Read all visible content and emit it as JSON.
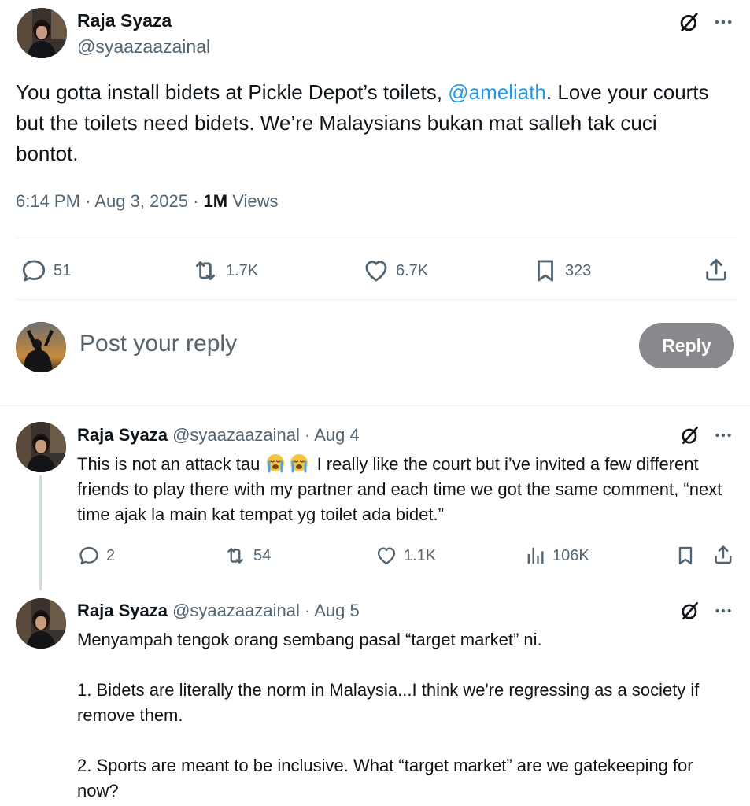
{
  "main_tweet": {
    "author_name": "Raja Syaza",
    "author_handle": "@syaazaazainal",
    "text_before": "You gotta install bidets at Pickle Depot’s toilets, ",
    "mention": "@ameliath",
    "text_after": ". Love your courts  but the toilets need bidets. We’re Malaysians bukan mat salleh tak cuci bontot.",
    "time": "6:14 PM",
    "date": "Aug 3, 2025",
    "views_count": "1M",
    "views_label": "Views",
    "separator": "·",
    "actions": {
      "replies": "51",
      "reposts": "1.7K",
      "likes": "6.7K",
      "bookmarks": "323"
    }
  },
  "composer": {
    "placeholder": "Post your reply",
    "reply_button": "Reply"
  },
  "replies": [
    {
      "author_name": "Raja Syaza",
      "author_handle": "@syaazaazainal",
      "date": "Aug 4",
      "text_first": "This is not an attack tau",
      "text_rest": " I really like the court but i’ve invited a few different friends to play there with my partner and each time we got the same comment, “next time ajak la main kat tempat yg toilet ada bidet.”",
      "actions": {
        "replies": "2",
        "reposts": "54",
        "likes": "1.1K",
        "views": "106K"
      }
    },
    {
      "author_name": "Raja Syaza",
      "author_handle": "@syaazaazainal",
      "date": "Aug 5",
      "paragraphs": [
        "Menyampah tengok orang sembang pasal “target market” ni.",
        "1. Bidets are literally the norm in Malaysia...I think we're regressing as a society if remove them.",
        "2. Sports are meant to be inclusive. What “target market” are we gatekeeping for now?"
      ]
    }
  ],
  "icons": {
    "grok": "grok-icon",
    "more": "more-icon",
    "reply": "reply-icon",
    "repost": "repost-icon",
    "like": "heart-icon",
    "bookmark": "bookmark-icon",
    "share": "share-icon",
    "views": "views-icon",
    "emoji": "crying-face-emoji"
  },
  "colors": {
    "accent": "#1d9bf0",
    "text": "#0f1419",
    "muted": "#536471",
    "reply_button_bg": "#87898c"
  }
}
